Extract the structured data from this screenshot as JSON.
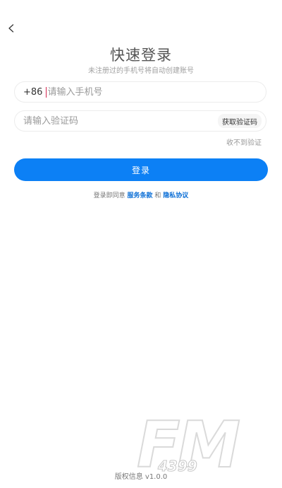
{
  "header": {
    "back_icon": "chevron-left-icon",
    "title": "快速登录",
    "subtitle": "未注册过的手机号将自动创建账号"
  },
  "phone_field": {
    "country_code": "+86",
    "value": "",
    "placeholder": "请输入手机号"
  },
  "code_field": {
    "value": "",
    "placeholder": "请输入验证码",
    "get_code_label": "获取验证码"
  },
  "no_code_link": "收不到验证",
  "login_button": {
    "label": "登录"
  },
  "agreement": {
    "prefix": "登录即同意 ",
    "terms_link": "服务条款",
    "conjunction": " 和 ",
    "privacy_link": "隐私协议"
  },
  "watermark": {
    "logo_text": "FM",
    "logo_number": "4399"
  },
  "footer": {
    "version": "版权信息 v1.0.0"
  },
  "colors": {
    "primary": "#0c80f5",
    "link": "#0c6fd6",
    "caret": "#d4264f"
  }
}
